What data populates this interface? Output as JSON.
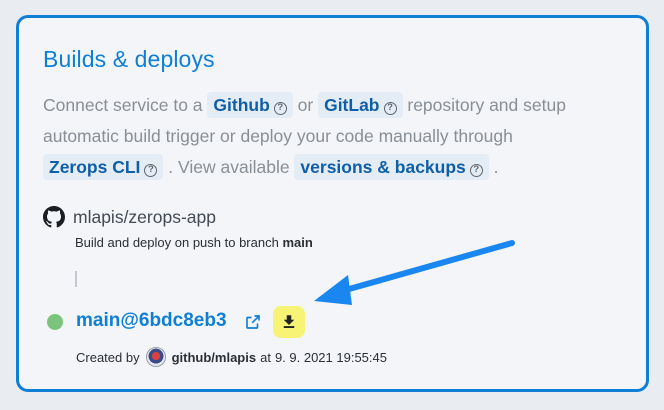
{
  "card": {
    "title": "Builds & deploys",
    "desc": {
      "part1": "Connect service to a ",
      "github": "Github",
      "part2": " or ",
      "gitlab": "GitLab",
      "part3": " repository and setup automatic build trigger or deploy your code manually through ",
      "zerops_cli": "Zerops CLI",
      "part4": ". View available ",
      "versions": "versions & backups",
      "part5": "."
    },
    "repo": {
      "icon": "github-icon",
      "name": "mlapis/zerops-app",
      "sub_prefix": "Build and deploy on push to branch ",
      "branch": "main"
    },
    "deploy": {
      "status_color": "#7cc47c",
      "commit": "main@6bdc8eb3",
      "created_by_label": "Created by",
      "user": "github/mlapis",
      "at_label": "at",
      "timestamp": "9. 9. 2021 19:55:45"
    }
  },
  "colors": {
    "accent": "#0f7fd6",
    "download_bg": "#f6f375",
    "arrow": "#1a86f0"
  }
}
